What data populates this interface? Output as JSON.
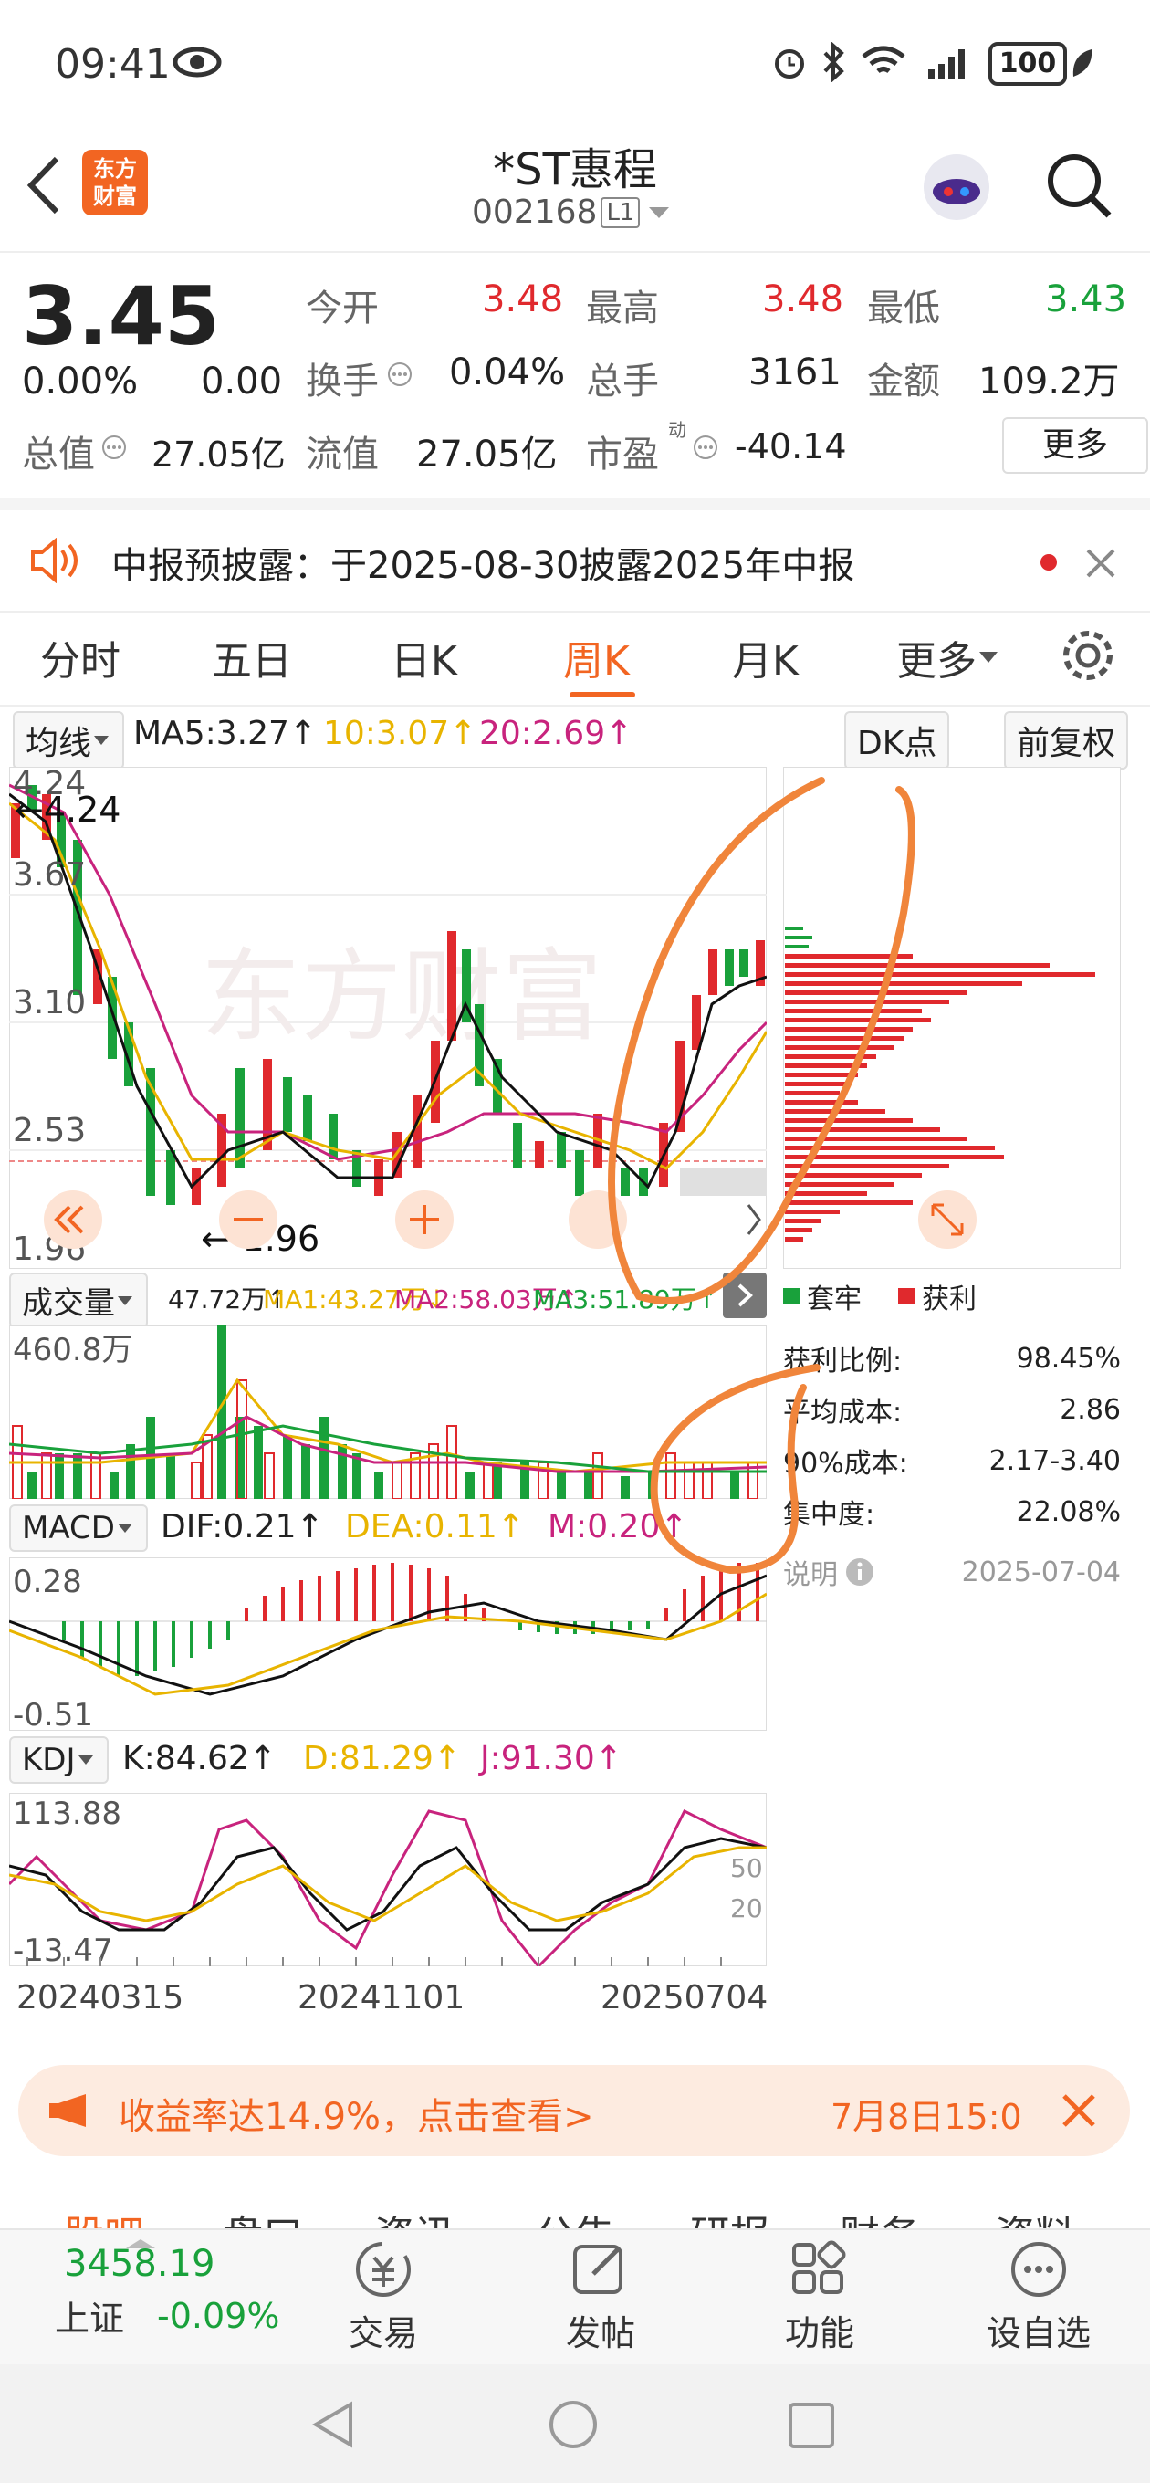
{
  "status": {
    "time": "09:41",
    "battery": "100"
  },
  "header": {
    "brand_line1": "东方",
    "brand_line2": "财富",
    "name": "*ST惠程",
    "code": "002168",
    "level": "L1"
  },
  "quote": {
    "price": "3.45",
    "change_pct": "0.00%",
    "change": "0.00",
    "open_label": "今开",
    "open": "3.48",
    "high_label": "最高",
    "high": "3.48",
    "low_label": "最低",
    "low": "3.43",
    "turnover_label": "换手",
    "turnover": "0.04%",
    "volume_label": "总手",
    "volume": "3161",
    "amount_label": "金额",
    "amount": "109.2万",
    "mktcap_label": "总值",
    "mktcap": "27.05亿",
    "float_label": "流值",
    "float": "27.05亿",
    "pe_label": "市盈",
    "pe_sup": "动",
    "pe": "-40.14",
    "more": "更多"
  },
  "notice": {
    "text": "中报预披露：于2025-08-30披露2025年中报"
  },
  "tabs": [
    {
      "label": "分时"
    },
    {
      "label": "五日"
    },
    {
      "label": "日K"
    },
    {
      "label": "周K"
    },
    {
      "label": "月K"
    },
    {
      "label": "更多"
    }
  ],
  "ma_bar": {
    "selector": "均线",
    "ma5": "MA5:3.27↑",
    "ma10": "10:3.07↑",
    "ma20": "20:2.69↑",
    "dk": "DK点",
    "adjust": "前复权"
  },
  "price_axis": {
    "y1": "4.24",
    "y2": "3.67",
    "y3": "3.10",
    "y4": "2.53",
    "y5": "1.96",
    "max_mark": "←4.24",
    "min_mark": "←-1.96"
  },
  "volume_bar": {
    "selector": "成交量",
    "vol": "47.72万↑",
    "ma1": "MA1:43.27万↓",
    "ma2": "MA2:58.03万↑",
    "ma3": "MA3:51.89万↑",
    "max": "460.8万"
  },
  "macd_bar": {
    "selector": "MACD",
    "dif": "DIF:0.21↑",
    "dea": "DEA:0.11↑",
    "m": "M:0.20↑",
    "top": "0.28",
    "bottom": "-0.51"
  },
  "kdj_bar": {
    "selector": "KDJ",
    "k": "K:84.62↑",
    "d": "D:81.29↑",
    "j": "J:91.30↑",
    "top": "113.88",
    "bottom": "-13.47",
    "r50": "50",
    "r20": "20"
  },
  "dates": {
    "d1": "20240315",
    "d2": "20241101",
    "d3": "20250704"
  },
  "chip": {
    "legend_trapped": "套牢",
    "legend_profit": "获利",
    "profit_ratio_label": "获利比例:",
    "profit_ratio": "98.45%",
    "avg_cost_label": "平均成本:",
    "avg_cost": "2.86",
    "cost90_label": "90%成本:",
    "cost90": "2.17-3.40",
    "concentration_label": "集中度:",
    "concentration": "22.08%",
    "explain": "说明",
    "date": "2025-07-04"
  },
  "banner": {
    "text": "收益率达14.9%，点击查看>",
    "time": "7月8日15:0"
  },
  "bottom_tabs": [
    "股吧",
    "盘口",
    "资讯",
    "公告",
    "研报",
    "财务",
    "资料"
  ],
  "bottom_nav": {
    "index_value": "3458.19",
    "index_name": "上证",
    "index_change": "-0.09%",
    "trade": "交易",
    "post": "发帖",
    "func": "功能",
    "watch": "设自选"
  },
  "colors": {
    "up": "#e0292d",
    "down": "#19a13b",
    "accent": "#f26522",
    "ma10": "#e8b400",
    "ma20": "#c8237d"
  }
}
